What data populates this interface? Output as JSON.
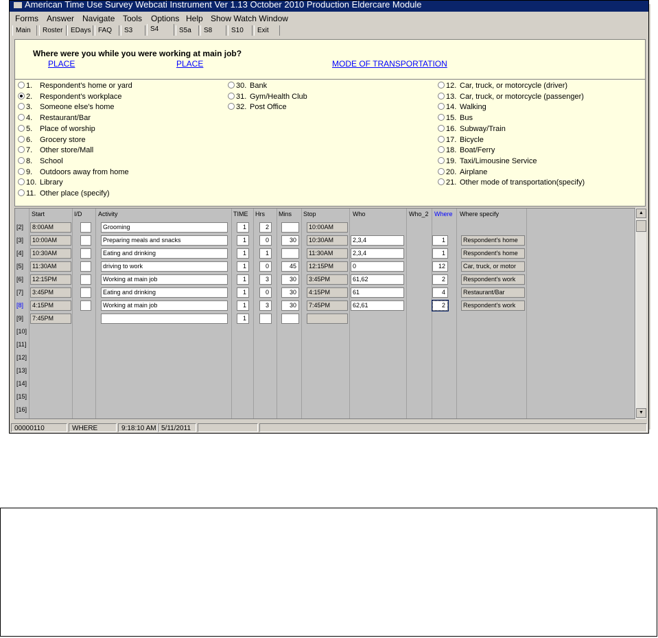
{
  "window": {
    "title": "American Time Use Survey Webcati Instrument Ver 1.13 October 2010 Production Eldercare Module"
  },
  "menu": [
    "Forms",
    "Answer",
    "Navigate",
    "Tools",
    "Options",
    "Help",
    "Show Watch Window"
  ],
  "tabs": [
    "Main",
    "Roster",
    "EDays",
    "FAQ",
    "S3",
    "S4",
    "S5a",
    "S8",
    "S10",
    "Exit"
  ],
  "question": {
    "text": "Where were you while you were working at main job?",
    "headers": [
      "PLACE",
      "PLACE",
      "MODE OF TRANSPORTATION"
    ]
  },
  "options_col1": [
    {
      "num": "1.",
      "label": "Respondent's home or yard",
      "selected": false
    },
    {
      "num": "2.",
      "label": "Respondent's workplace",
      "selected": true
    },
    {
      "num": "3.",
      "label": "Someone else's home",
      "selected": false
    },
    {
      "num": "4.",
      "label": "Restaurant/Bar",
      "selected": false
    },
    {
      "num": "5.",
      "label": "Place of worship",
      "selected": false
    },
    {
      "num": "6.",
      "label": "Grocery store",
      "selected": false
    },
    {
      "num": "7.",
      "label": "Other store/Mall",
      "selected": false
    },
    {
      "num": "8.",
      "label": "School",
      "selected": false
    },
    {
      "num": "9.",
      "label": "Outdoors away from home",
      "selected": false
    },
    {
      "num": "10.",
      "label": "Library",
      "selected": false
    },
    {
      "num": "11.",
      "label": "Other place (specify)",
      "selected": false
    }
  ],
  "options_col2": [
    {
      "num": "30.",
      "label": "Bank"
    },
    {
      "num": "31.",
      "label": "Gym/Health Club"
    },
    {
      "num": "32.",
      "label": "Post Office"
    }
  ],
  "options_col3": [
    {
      "num": "12.",
      "label": "Car, truck, or motorcycle (driver)"
    },
    {
      "num": "13.",
      "label": "Car, truck, or motorcycle (passenger)"
    },
    {
      "num": "14.",
      "label": "Walking"
    },
    {
      "num": "15.",
      "label": "Bus"
    },
    {
      "num": "16.",
      "label": "Subway/Train"
    },
    {
      "num": "17.",
      "label": "Bicycle"
    },
    {
      "num": "18.",
      "label": "Boat/Ferry"
    },
    {
      "num": "19.",
      "label": "Taxi/Limousine Service"
    },
    {
      "num": "20.",
      "label": "Airplane"
    },
    {
      "num": "21.",
      "label": "Other mode of transportation(specify)"
    }
  ],
  "grid": {
    "headers": [
      "Start",
      "I/D",
      "Activity",
      "TIME",
      "Hrs",
      "Mins",
      "Stop",
      "Who",
      "Who_2",
      "Where",
      "Where specify"
    ],
    "row_labels": [
      "[2]",
      "[3]",
      "[4]",
      "[5]",
      "[6]",
      "[7]",
      "[8]",
      "[9]",
      "[10]",
      "[11]",
      "[12]",
      "[13]",
      "[14]",
      "[15]",
      "[16]"
    ],
    "rows": [
      {
        "start": "8:00AM",
        "activity": "Grooming",
        "time": "1",
        "hrs": "2",
        "mins": "",
        "stop": "10:00AM",
        "who": "",
        "where": "",
        "where_specify": ""
      },
      {
        "start": "10:00AM",
        "activity": "Preparing meals and snacks",
        "time": "1",
        "hrs": "0",
        "mins": "30",
        "stop": "10:30AM",
        "who": "2,3,4",
        "where": "1",
        "where_specify": "Respondent's home"
      },
      {
        "start": "10:30AM",
        "activity": "Eating and drinking",
        "time": "1",
        "hrs": "1",
        "mins": "",
        "stop": "11:30AM",
        "who": "2,3,4",
        "where": "1",
        "where_specify": "Respondent's home"
      },
      {
        "start": "11:30AM",
        "activity": "driving to work",
        "time": "1",
        "hrs": "0",
        "mins": "45",
        "stop": "12:15PM",
        "who": "0",
        "where": "12",
        "where_specify": "Car, truck, or motor"
      },
      {
        "start": "12:15PM",
        "activity": "Working at main job",
        "time": "1",
        "hrs": "3",
        "mins": "30",
        "stop": "3:45PM",
        "who": "61,62",
        "where": "2",
        "where_specify": "Respondent's work"
      },
      {
        "start": "3:45PM",
        "activity": "Eating and drinking",
        "time": "1",
        "hrs": "0",
        "mins": "30",
        "stop": "4:15PM",
        "who": "61",
        "where": "4",
        "where_specify": "Restaurant/Bar"
      },
      {
        "start": "4:15PM",
        "activity": "Working at main job",
        "time": "1",
        "hrs": "3",
        "mins": "30",
        "stop": "7:45PM",
        "who": "62,61",
        "where": "2",
        "where_specify": "Respondent's work"
      },
      {
        "start": "7:45PM",
        "activity": "",
        "time": "1",
        "hrs": "",
        "mins": "",
        "stop": "",
        "who": "",
        "where": "",
        "where_specify": ""
      }
    ]
  },
  "status": [
    "00000110",
    "WHERE",
    "9:18:10 AM",
    "5/11/2011"
  ],
  "colors": {
    "title_bar": "#0a246a",
    "panel_bg": "#ffffe1",
    "link": "#0000ff",
    "face": "#d4d0c8"
  }
}
